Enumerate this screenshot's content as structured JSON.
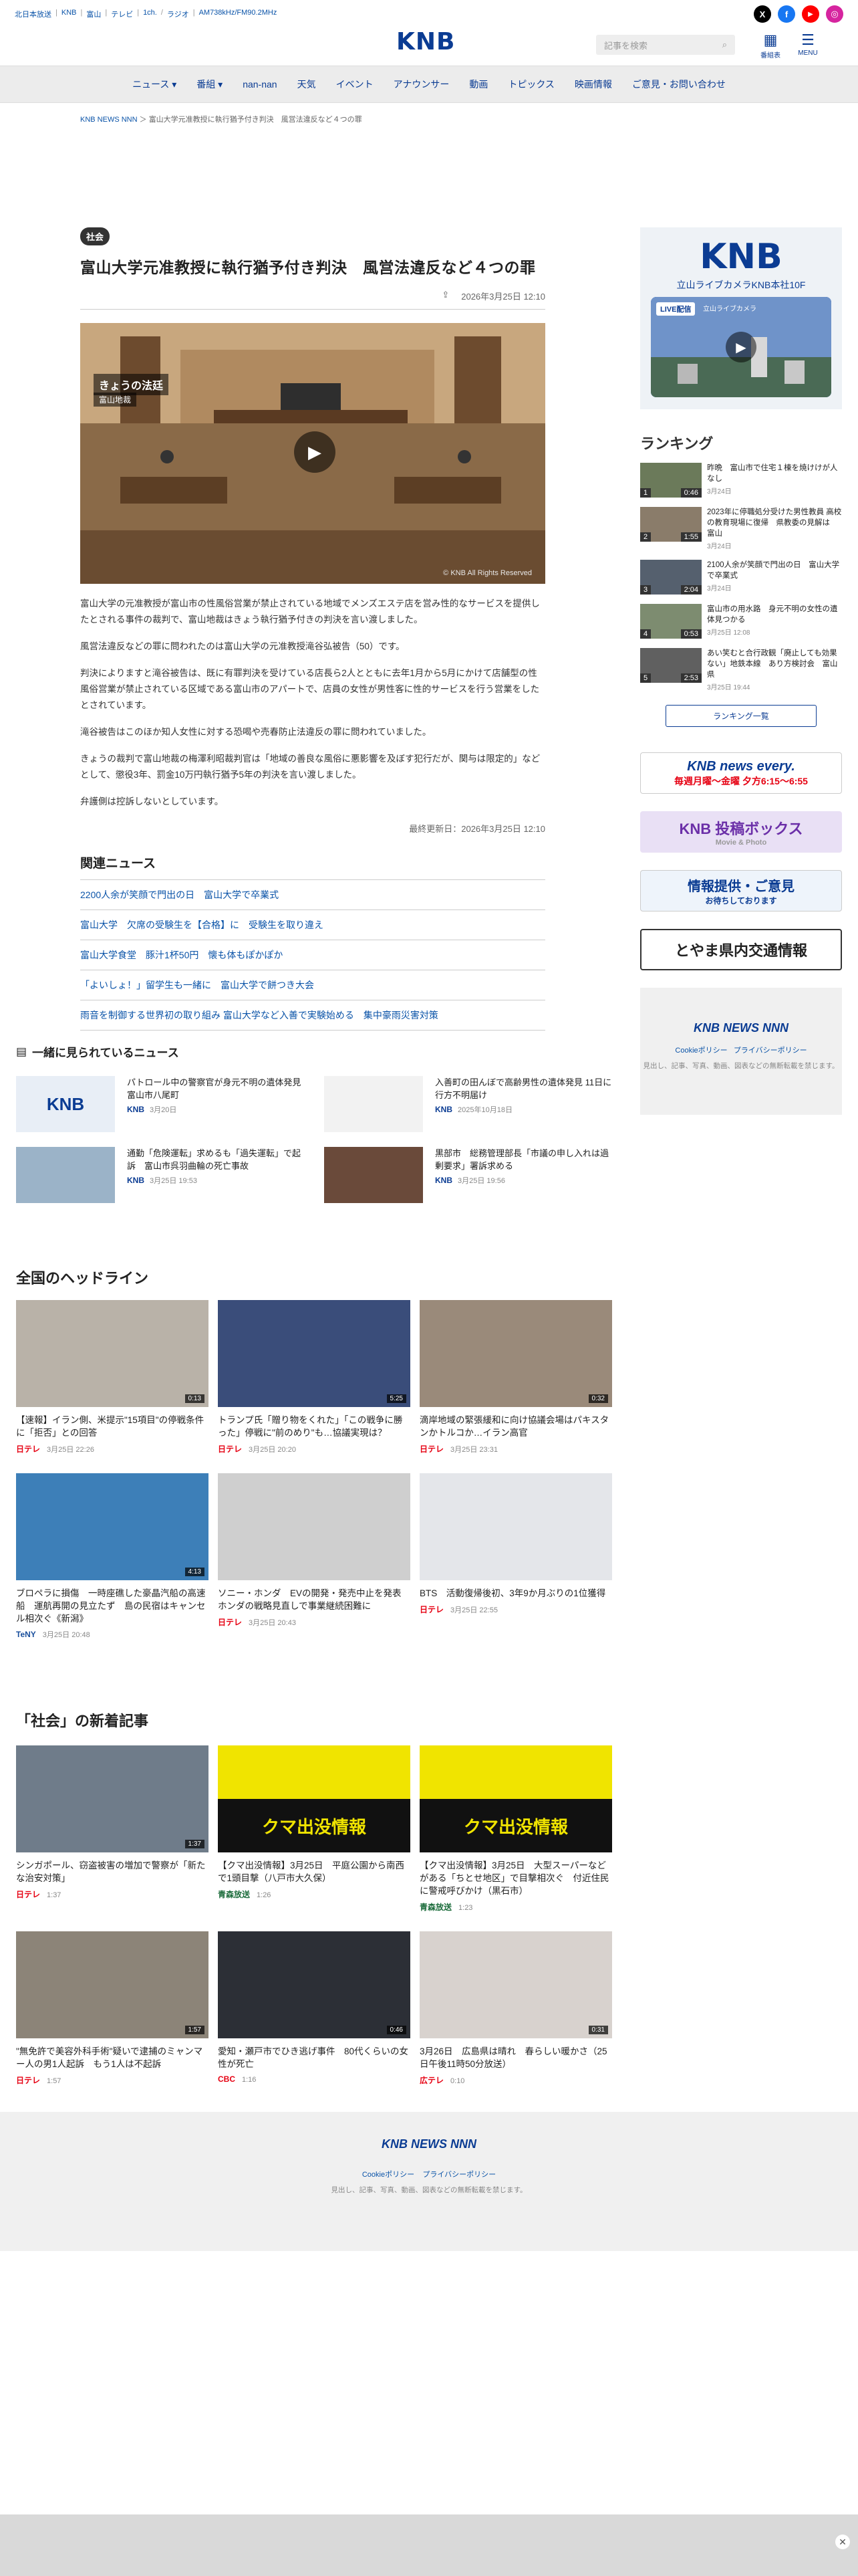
{
  "topbar": {
    "links": [
      "北日本放送",
      "KNB",
      "富山",
      "テレビ",
      "1ch.",
      "ラジオ",
      "AM738kHz/FM90.2MHz"
    ],
    "social": [
      {
        "icon": "x-icon",
        "label": "X",
        "color": "#000000"
      },
      {
        "icon": "facebook-icon",
        "label": "f",
        "color": "#1877f2"
      },
      {
        "icon": "youtube-icon",
        "label": "▶",
        "color": "#ff0000"
      },
      {
        "icon": "instagram-icon",
        "label": "◎",
        "color": "#d6249f"
      }
    ]
  },
  "header": {
    "logo": "KNB",
    "search_placeholder": "記事を検索",
    "program_label": "番組表",
    "menu_label": "MENU"
  },
  "nav": [
    "ニュース ▾",
    "番組 ▾",
    "nan-nan",
    "天気",
    "イベント",
    "アナウンサー",
    "動画",
    "トピックス",
    "映画情報",
    "ご意見・お問い合わせ"
  ],
  "breadcrumb": {
    "home": "KNB NEWS NNN",
    "current": "富山大学元准教授に執行猶予付き判決　風営法違反など４つの罪"
  },
  "article": {
    "category": "社会",
    "title": "富山大学元准教授に執行猶予付き判決　風営法違反など４つの罪",
    "date": "2026年3月25日 12:10",
    "video_caption_top": "きょうの法廷",
    "video_caption_sub": "富山地裁",
    "video_watermark": "© KNB All Rights Reserved",
    "paragraphs": [
      "富山大学の元准教授が富山市の性風俗営業が禁止されている地域でメンズエステ店を営み性的なサービスを提供したとされる事件の裁判で、富山地裁はきょう執行猶予付きの判決を言い渡しました。",
      "風営法違反などの罪に問われたのは富山大学の元准教授滝谷弘被告（50）です。",
      "判決によりますと滝谷被告は、既に有罪判決を受けている店長ら2人とともに去年1月から5月にかけて店舗型の性風俗営業が禁止されている区域である富山市のアパートで、店員の女性が男性客に性的サービスを行う営業をしたとされています。",
      "滝谷被告はこのほか知人女性に対する恐喝や売春防止法違反の罪に問われていました。",
      "きょうの裁判で富山地裁の梅澤利昭裁判官は「地域の善良な風俗に悪影響を及ぼす犯行だが、関与は限定的」などとして、懲役3年、罰金10万円執行猶予5年の判決を言い渡しました。",
      "弁護側は控訴しないとしています。"
    ],
    "updated": "最終更新日：2026年3月25日 12:10"
  },
  "related": {
    "title": "関連ニュース",
    "items": [
      "2200人余が笑顔で門出の日　富山大学で卒業式",
      "富山大学　欠席の受験生を【合格】に　受験生を取り違え",
      "富山大学食堂　豚汁1杯50円　懐も体もぽかぽか",
      "「よいしょ！」留学生も一緒に　富山大学で餅つき大会",
      "雨音を制御する世界初の取り組み 富山大学など入善で実験始める　集中豪雨災害対策"
    ]
  },
  "sidebar": {
    "live_logo": "KNB",
    "live_caption": "立山ライブカメラKNB本社10F",
    "live_badge": "LIVE配信",
    "live_badge_sub": "立山ライブカメラ",
    "ranking_title": "ランキング",
    "ranking": [
      {
        "rank": "1",
        "title": "昨晩　富山市で住宅１棟を焼けけが人なし",
        "date": "3月24日",
        "dur": "0:46"
      },
      {
        "rank": "2",
        "title": "2023年に停職処分受けた男性教員 高校の教育現場に復帰　県教委の見解は　富山",
        "date": "3月24日",
        "dur": "1:55"
      },
      {
        "rank": "3",
        "title": "2100人余が笑顔で門出の日　富山大学で卒業式",
        "date": "3月24日",
        "dur": "2:04"
      },
      {
        "rank": "4",
        "title": "富山市の用水路　身元不明の女性の遺体見つかる",
        "date": "3月25日 12:08",
        "dur": "0:53"
      },
      {
        "rank": "5",
        "title": "あい笑むと合行政観「廃止しても効果ない」地鉄本線　あり方検討会　富山県",
        "date": "3月25日 19:44",
        "dur": "2:53"
      }
    ],
    "ranking_more": "ランキング一覧",
    "banners": [
      {
        "name": "every-banner",
        "line1": "KNB news every.",
        "line2": "毎週月曜〜金曜 夕方6:15〜6:55"
      },
      {
        "name": "toukou-banner",
        "line1": "KNB 投稿ボックス",
        "line2": "Movie & Photo"
      },
      {
        "name": "info-banner",
        "line1": "情報提供・ご意見",
        "line2": "お待ちしております"
      },
      {
        "name": "traffic-banner",
        "line1": "とやま県内交通情報",
        "line2": ""
      }
    ],
    "nnn_logo": "KNB NEWS NNN",
    "policy": [
      "Cookieポリシー",
      "プライバシーポリシー"
    ],
    "copyright": "見出し、記事、写真、動画、図表などの無断転載を禁じます。"
  },
  "watch": {
    "title": "一緒に見られているニュース",
    "items": [
      {
        "title": "パトロール中の警察官が身元不明の遺体発見　富山市八尾町",
        "src": "KNB",
        "date": "3月20日"
      },
      {
        "title": "入善町の田んぼで高齢男性の遺体発見 11日に行方不明届け",
        "src": "KNB",
        "date": "2025年10月18日"
      },
      {
        "title": "通勤「危険運転」求めるも「過失運転」で起訴　富山市呉羽曲輪の死亡事故",
        "src": "KNB",
        "date": "3月25日 19:53"
      },
      {
        "title": "黒部市　総務管理部長「市議の申し入れは過剰要求」署訴求める",
        "src": "KNB",
        "date": "3月25日 19:56"
      }
    ]
  },
  "national": {
    "title": "全国のヘッドライン",
    "items": [
      {
        "title": "【速報】イラン側、米提示\"15項目\"の停戦条件に「拒否」との回答",
        "src": "日テレ",
        "date": "3月25日 22:26",
        "dur": "0:13"
      },
      {
        "title": "トランプ氏「贈り物をくれた」「この戦争に勝った」停戦に\"前のめり\"も…協議実現は？",
        "src": "日テレ",
        "date": "3月25日 20:20",
        "dur": "5:25"
      },
      {
        "title": "滴岸地域の緊張緩和に向け協議会場はパキスタンかトルコか…イラン高官",
        "src": "日テレ",
        "date": "3月25日 23:31",
        "dur": "0:32"
      },
      {
        "title": "ブロペラに損傷　一時座礁した豪晶汽船の高速船　運航再開の見立たず　島の民宿はキャンセル相次ぐ《新潟》",
        "src": "TeNY",
        "date": "3月25日 20:48",
        "dur": "4:13"
      },
      {
        "title": "ソニー・ホンダ　EVの開発・発売中止を発表　ホンダの戦略見直しで事業継続困難に",
        "src": "日テレ",
        "date": "3月25日 20:43",
        "dur": ""
      },
      {
        "title": "BTS　活動復帰後初、3年9か月ぶりの1位獲得",
        "src": "日テレ",
        "date": "3月25日 22:55",
        "dur": ""
      }
    ]
  },
  "social_news": {
    "title": "「社会」の新着記事",
    "items": [
      {
        "title": "シンガポール、窃盗被害の増加で警察が「新たな治安対策」",
        "src": "日テレ",
        "date": "1:37",
        "dur": "1:37"
      },
      {
        "title": "【クマ出没情報】3月25日　平庭公園から南西で1頭目撃（八戸市大久保）",
        "src": "青森放送",
        "date": "1:26",
        "dur": ""
      },
      {
        "title": "【クマ出没情報】3月25日　大型スーパーなどがある「ちとせ地区」で目撃相次ぐ　付近住民に警戒呼びかけ（黒石市）",
        "src": "青森放送",
        "date": "1:23",
        "dur": ""
      },
      {
        "title": "\"無免許で美容外科手術\"疑いで逮捕のミャンマー人の男1人起訴　もう1人は不起訴",
        "src": "日テレ",
        "date": "1:57",
        "dur": "1:57"
      },
      {
        "title": "愛知・瀬戸市でひき逃げ事件　80代くらいの女性が死亡",
        "src": "CBC",
        "date": "1:16",
        "dur": "0:46"
      },
      {
        "title": "3月26日　広島県は晴れ　春らしい暖かさ（25日午後11時50分放送）",
        "src": "広テレ",
        "date": "0:10",
        "dur": "0:31"
      }
    ],
    "bear_text": "クマ出没情報"
  },
  "footer": {
    "logo": "KNB NEWS NNN",
    "policy": [
      "Cookieポリシー",
      "プライバシーポリシー"
    ],
    "copyright": "見出し、記事、写真、動画、図表などの無断転載を禁じます。"
  },
  "colors": {
    "brand": "#0b3c93",
    "link": "#0a53a8",
    "ntv": "#e60012"
  }
}
